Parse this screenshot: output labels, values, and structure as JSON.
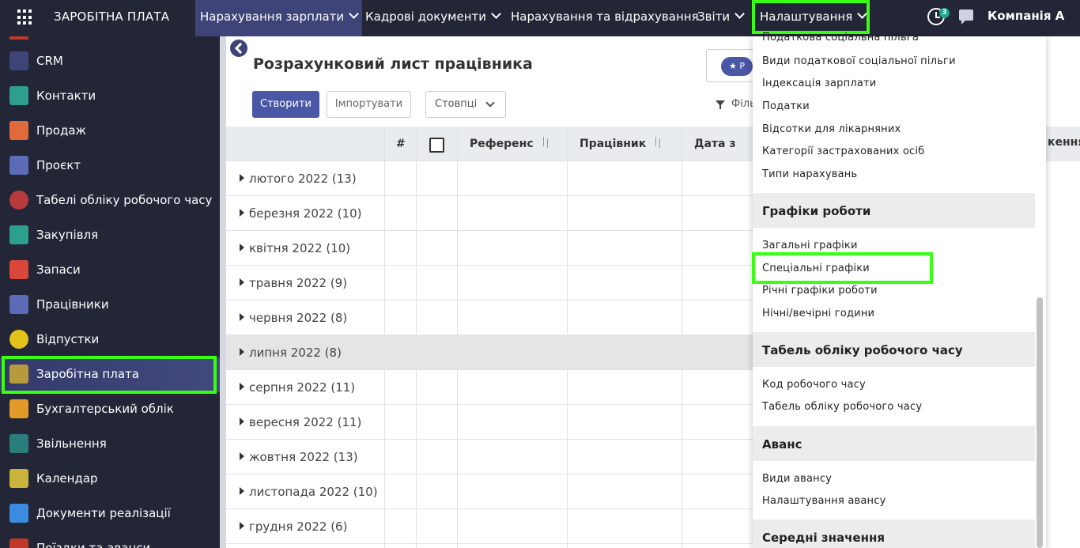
{
  "topbar": {
    "app_title": "ЗАРОБІТНА ПЛАТА",
    "menu": [
      {
        "label": "Нарахування зарплати"
      },
      {
        "label": "Кадрові документи"
      },
      {
        "label": "Нарахування та відрахування"
      },
      {
        "label": "Звіти"
      },
      {
        "label": "Налаштування"
      }
    ],
    "activity_count": "3",
    "company": "Компанія А"
  },
  "sidebar": {
    "items": [
      {
        "label": "CRM",
        "icon": "handshake-icon",
        "color": "#3e4478"
      },
      {
        "label": "Контакти",
        "icon": "contacts-icon",
        "color": "#2e9e8f"
      },
      {
        "label": "Продаж",
        "icon": "sales-chart-icon",
        "color": "#e06a3b"
      },
      {
        "label": "Проєкт",
        "icon": "puzzle-icon",
        "color": "#5b6bb6"
      },
      {
        "label": "Табелі обліку робочого часу",
        "icon": "timesheet-clock-icon",
        "color": "#b73b3b"
      },
      {
        "label": "Закупівля",
        "icon": "purchase-card-icon",
        "color": "#2e9e8f"
      },
      {
        "label": "Запаси",
        "icon": "inventory-box-icon",
        "color": "#d9463b"
      },
      {
        "label": "Працівники",
        "icon": "employees-icon",
        "color": "#5b6bb6"
      },
      {
        "label": "Відпустки",
        "icon": "vacation-sun-icon",
        "color": "#e3c21c"
      },
      {
        "label": "Заробітна плата",
        "icon": "payroll-icon",
        "color": "#b69b3a"
      },
      {
        "label": "Бухгалтерський облік",
        "icon": "accounting-icon",
        "color": "#e39a2b"
      },
      {
        "label": "Звільнення",
        "icon": "dismissal-icon",
        "color": "#2a7d7a"
      },
      {
        "label": "Календар",
        "icon": "calendar-icon",
        "color": "#c9b33b"
      },
      {
        "label": "Документи реалізації",
        "icon": "sales-documents-icon",
        "color": "#3b8be0"
      },
      {
        "label": "Поїздки та аванси",
        "icon": "trips-icon",
        "color": "#c0392b"
      }
    ]
  },
  "page": {
    "title": "Розрахунковий лист працівника",
    "create_label": "Створити",
    "import_label": "Імпортувати",
    "columns_label": "Стовпці",
    "favorite_chip": "★ Р",
    "filter_label": "Філь"
  },
  "table": {
    "headers": {
      "number": "#",
      "reference": "Референс",
      "employee": "Працівник",
      "date_from": "Дата з",
      "right_partial": "кення"
    },
    "groups": [
      {
        "label": "лютого 2022 (13)"
      },
      {
        "label": "березня 2022 (10)"
      },
      {
        "label": "квітня 2022 (10)"
      },
      {
        "label": "травня 2022 (9)"
      },
      {
        "label": "червня 2022 (8)"
      },
      {
        "label": "липня 2022 (8)"
      },
      {
        "label": "серпня 2022 (11)"
      },
      {
        "label": "вересня 2022 (11)"
      },
      {
        "label": "жовтня 2022 (13)"
      },
      {
        "label": "листопада 2022 (10)"
      },
      {
        "label": "грудня 2022 (6)"
      }
    ]
  },
  "dropdown": {
    "items_top": [
      "Податкова соціальна пільга",
      "Види податкової соціальної пільги",
      "Індексація зарплати",
      "Податки",
      "Відсотки для лікарняних",
      "Категорії застрахованих осіб",
      "Типи нарахувань"
    ],
    "section_schedules": "Графіки роботи",
    "items_schedules": [
      "Загальні графіки",
      "Спеціальні графіки",
      "Річні графіки роботи",
      "Нічні/вечірні години"
    ],
    "section_timesheet": "Табель обліку робочого часу",
    "items_timesheet": [
      "Код робочого часу",
      "Табель обліку робочого часу"
    ],
    "section_advance": "Аванс",
    "items_advance": [
      "Види авансу",
      "Налаштування авансу"
    ],
    "section_average": "Середні значення"
  },
  "accent_colors": {
    "navbar": "#232637",
    "primary": "#4a56a6",
    "highlight": "#39ff14"
  }
}
